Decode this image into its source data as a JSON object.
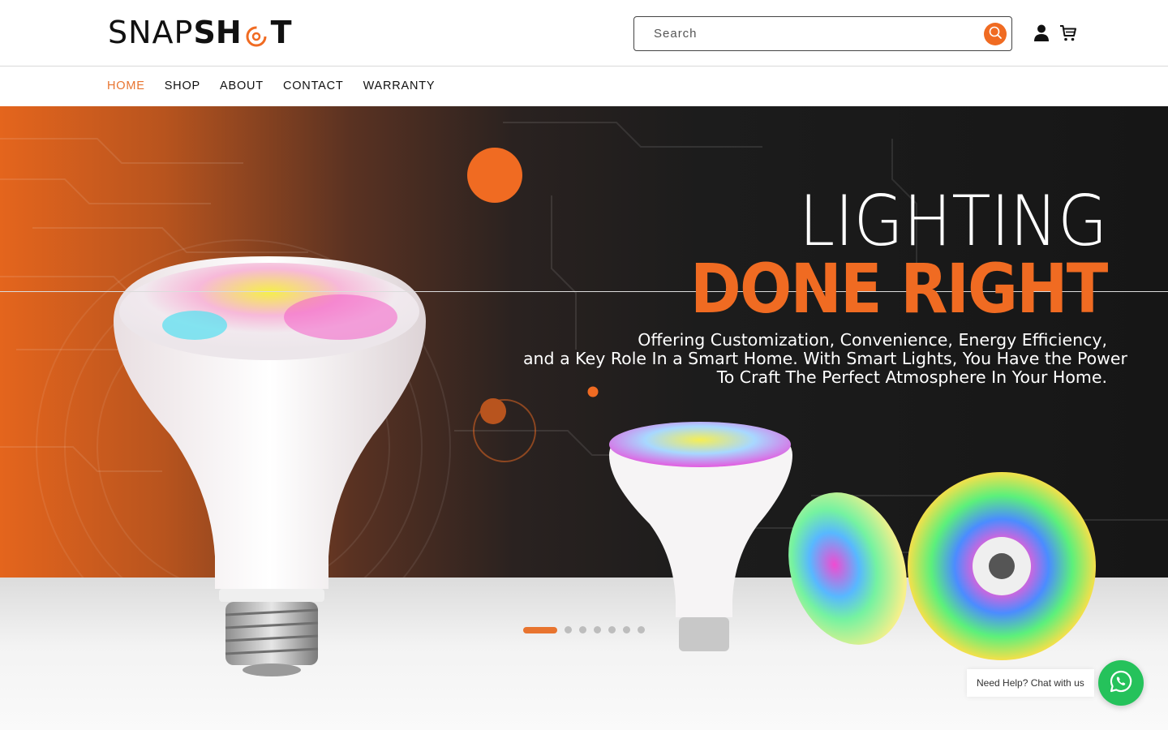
{
  "header": {
    "logo": {
      "left": "SNAP",
      "bold": "SH",
      "tail": "T"
    },
    "search": {
      "placeholder": "Search"
    },
    "icons": {
      "search": "search-icon",
      "account": "account-icon",
      "cart": "cart-icon"
    }
  },
  "nav": {
    "items": [
      {
        "label": "HOME",
        "active": true
      },
      {
        "label": "SHOP",
        "active": false
      },
      {
        "label": "ABOUT",
        "active": false
      },
      {
        "label": "CONTACT",
        "active": false
      },
      {
        "label": "WARRANTY",
        "active": false
      }
    ]
  },
  "hero": {
    "headline_1": "LIGHTING",
    "headline_2": "DONE RIGHT",
    "subcopy": [
      "Offering Customization, Convenience, Energy Efficiency,",
      "and a Key Role In a Smart Home. With Smart Lights, You Have the Power",
      "To Craft The Perfect Atmosphere In Your Home."
    ],
    "slides_total": 7,
    "active_slide": 1
  },
  "chat": {
    "label": "Need Help? Chat with us",
    "icon": "whatsapp-icon"
  },
  "colors": {
    "accent": "#f06b22",
    "nav_active": "#e8742f",
    "chat_green": "#25c25b"
  }
}
